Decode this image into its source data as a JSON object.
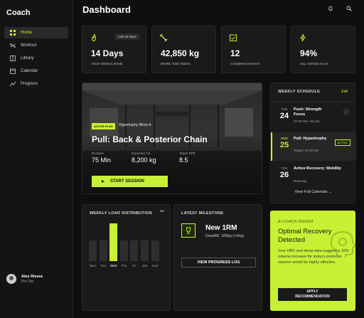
{
  "brand": "Coach",
  "nav": [
    {
      "label": "Home",
      "icon": "grid-icon",
      "active": true
    },
    {
      "label": "Workout",
      "icon": "dumbbell-icon",
      "active": false
    },
    {
      "label": "Library",
      "icon": "book-icon",
      "active": false
    },
    {
      "label": "Calendar",
      "icon": "calendar-icon",
      "active": false
    },
    {
      "label": "Progress",
      "icon": "trending-icon",
      "active": false
    }
  ],
  "user": {
    "name": "Alex Rivera",
    "tier": "Pro Tier"
  },
  "header": {
    "title": "Dashboard"
  },
  "stats": [
    {
      "value": "14 Days",
      "label": "Active Workout Streak",
      "icon": "flame-icon",
      "pill": "Last 30 Days"
    },
    {
      "value": "42,850 kg",
      "label": "Weekly Total Volume",
      "icon": "dumbbell-icon"
    },
    {
      "value": "12",
      "label": "Completed Sessions",
      "icon": "check-calendar-icon"
    },
    {
      "value": "94%",
      "label": "Avg. Intensity Score",
      "icon": "bolt-icon"
    }
  ],
  "active_plan": {
    "badge": "ACTIVE PLAN",
    "program": "Hypertrophy Block A",
    "title": "Pull: Back & Posterior Chain",
    "metrics": [
      {
        "label": "Duration",
        "value": "75 Min"
      },
      {
        "label": "Expected Vol.",
        "value": "8,200 kg"
      },
      {
        "label": "Target RPE",
        "value": "8.5"
      }
    ],
    "start_label": "START SESSION"
  },
  "schedule": {
    "title": "WEEKLY SCHEDULE",
    "edit_label": "Edit",
    "items": [
      {
        "day": "TUE",
        "date": "24",
        "name": "Push: Strength Focus",
        "time": "07:00 AM • 90 min",
        "tag": ""
      },
      {
        "day": "WED",
        "date": "25",
        "name": "Pull: Hypertrophy",
        "time": "Today • 11:30 AM",
        "tag": "ACTIVE"
      },
      {
        "day": "THU",
        "date": "26",
        "name": "Active Recovery: Mobility",
        "time": "Rest Day",
        "tag": ""
      }
    ],
    "footer": "View Full Calendar →"
  },
  "load": {
    "title": "WEEKLY LOAD DISTRIBUTION",
    "menu": "•••",
    "days": [
      "Mon",
      "Tue",
      "Wed",
      "Thu",
      "Fri",
      "Sat",
      "Sun"
    ],
    "values": [
      0.55,
      0.55,
      1.0,
      0.55,
      0.55,
      0.55,
      0.55
    ],
    "highlight_index": 2
  },
  "milestone": {
    "title": "LATEST MILESTONE",
    "value": "New 1RM",
    "detail": "Deadlift: 185kg (+5kg)",
    "button": "VIEW PROGRESS LOG"
  },
  "coach": {
    "label": "AI COACH INSIGHT",
    "title": "Optimal Recovery Detected",
    "body": "Your HRV and sleep data suggest a 10% volume increase for today's posterior session would be highly effective.",
    "button_line1": "APPLY",
    "button_line2": "RECOMMENDATION"
  },
  "colors": {
    "accent": "#c8f135",
    "bg": "#0f0f0f",
    "card": "#1a1a1a"
  }
}
